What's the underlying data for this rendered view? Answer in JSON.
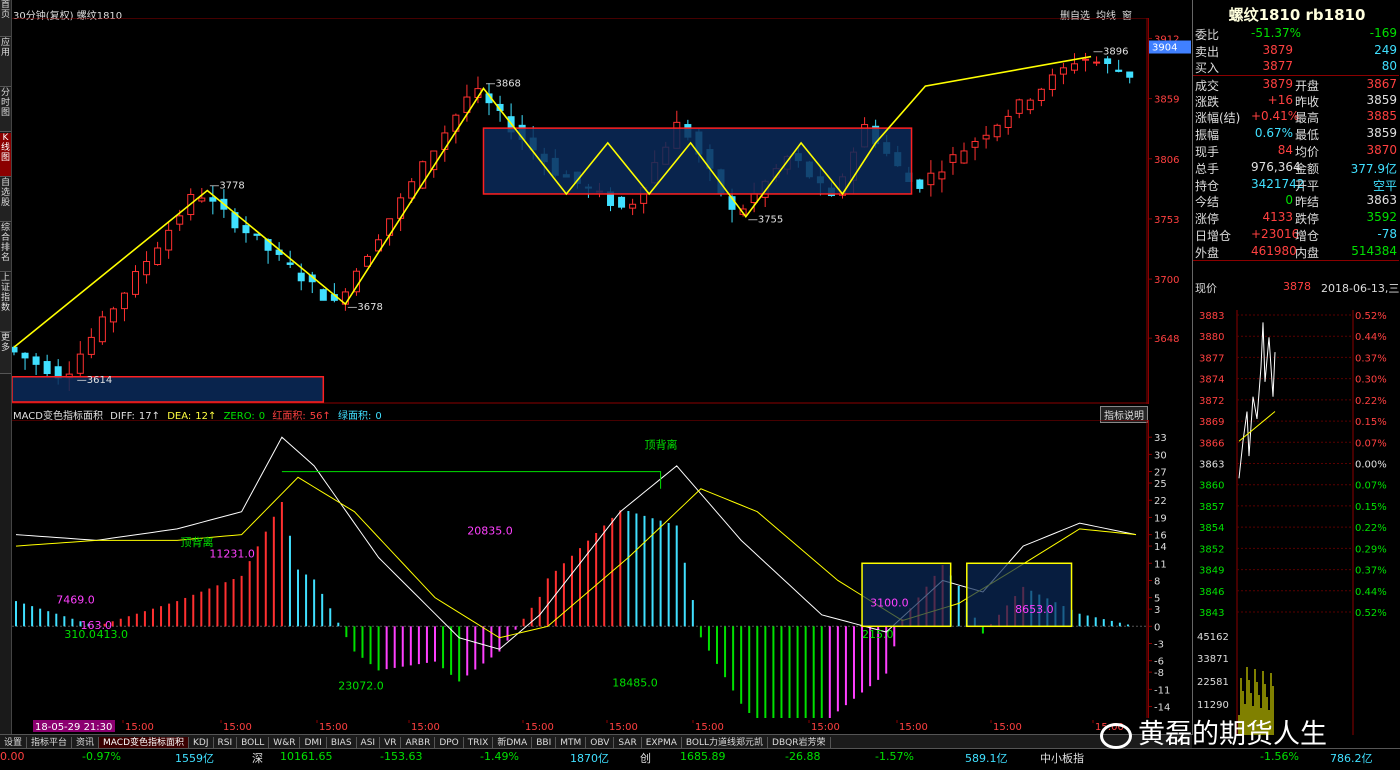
{
  "window": {
    "title": "30分钟(复权)  螺纹1810",
    "tools": [
      "删自选",
      "均线",
      "窗"
    ]
  },
  "sidebar": {
    "items": [
      "首页",
      "应用",
      "分时图",
      "K线图",
      "自选股",
      "综合排名",
      "上证指数",
      "更多"
    ],
    "active_index": 3
  },
  "price_axis": {
    "labels": [
      "3912",
      "3859",
      "3806",
      "3753",
      "3700",
      "3648"
    ],
    "current_tag": "3904"
  },
  "price_annotations": [
    {
      "label": "3614",
      "kind": "low"
    },
    {
      "label": "3778",
      "kind": "high"
    },
    {
      "label": "3678",
      "kind": "low"
    },
    {
      "label": "3868",
      "kind": "high"
    },
    {
      "label": "3755",
      "kind": "low"
    },
    {
      "label": "3896",
      "kind": "high"
    }
  ],
  "macd": {
    "header": {
      "name": "MACD变色指标面积",
      "diff_label": "DIFF:",
      "diff_value": "17↑",
      "dea_label": "DEA:",
      "dea_value": "12↑",
      "zero_label": "ZERO:",
      "zero_value": "0",
      "red_label": "红面积:",
      "red_value": "56↑",
      "green_label": "绿面积:",
      "green_value": "0"
    },
    "help_button": "指标说明",
    "axis_labels": [
      "33",
      "30",
      "27",
      "25",
      "22",
      "19",
      "16",
      "14",
      "11",
      "8",
      "5",
      "3",
      "0",
      "-3",
      "-6",
      "-8",
      "-11",
      "-14"
    ],
    "annotations": [
      {
        "text": "顶背离",
        "color": "#00e000"
      },
      {
        "text": "顶背离",
        "color": "#00e000"
      },
      {
        "text": "7469.0",
        "color": "#ff40ff"
      },
      {
        "text": "310.0",
        "color": "#00e000"
      },
      {
        "text": "413.0",
        "color": "#00e000"
      },
      {
        "text": "163.0",
        "color": "#ff40ff"
      },
      {
        "text": "11231.0",
        "color": "#ff40ff"
      },
      {
        "text": "23072.0",
        "color": "#00e000"
      },
      {
        "text": "20835.0",
        "color": "#ff40ff"
      },
      {
        "text": "18485.0",
        "color": "#00e000"
      },
      {
        "text": "3100.0",
        "color": "#ff40ff"
      },
      {
        "text": "215.0",
        "color": "#00e000"
      },
      {
        "text": "8653.0",
        "color": "#ff40ff"
      }
    ]
  },
  "time_axis": {
    "cursor_label": "18-05-29 21:30",
    "labels": [
      "15:00",
      "15:00",
      "15:00",
      "15:00",
      "15:00",
      "15:00",
      "15:00",
      "15:00",
      "15:00",
      "15:00",
      "15:00"
    ]
  },
  "tabs": [
    "设置",
    "指标平台",
    "资讯",
    "MACD变色指标面积",
    "KDJ",
    "RSI",
    "BOLL",
    "W&R",
    "DMI",
    "BIAS",
    "ASI",
    "VR",
    "ARBR",
    "DPO",
    "TRIX",
    "新DMA",
    "BBI",
    "MTM",
    "OBV",
    "SAR",
    "EXPMA",
    "BOLL力道线郑元凯",
    "DBQR岩芳荣"
  ],
  "active_tab": 3,
  "status_bar": [
    {
      "text": "0.00",
      "color": "#ff4040"
    },
    {
      "text": "-0.97%",
      "color": "#00e000"
    },
    {
      "text": "1559亿",
      "color": "#40e0ff"
    },
    {
      "text": "深",
      "color": "#e0e0e0"
    },
    {
      "text": "10161.65",
      "color": "#00e000"
    },
    {
      "text": "-153.63",
      "color": "#00e000"
    },
    {
      "text": "-1.49%",
      "color": "#00e000"
    },
    {
      "text": "1870亿",
      "color": "#40e0ff"
    },
    {
      "text": "创",
      "color": "#e0e0e0"
    },
    {
      "text": "1685.89",
      "color": "#00e000"
    },
    {
      "text": "-26.88",
      "color": "#00e000"
    },
    {
      "text": "-1.57%",
      "color": "#00e000"
    },
    {
      "text": "589.1亿",
      "color": "#40e0ff"
    },
    {
      "text": "中小板指",
      "color": "#e0e0e0"
    },
    {
      "text": "-1.56%",
      "color": "#00e000"
    },
    {
      "text": "786.2亿",
      "color": "#40e0ff"
    }
  ],
  "quote": {
    "title": "螺纹1810 rb1810",
    "rows": [
      {
        "l1": "委比",
        "v1": "-51.37%",
        "c1": "#00e000",
        "l2": "",
        "v2": "-169",
        "c2": "#00e000"
      },
      {
        "l1": "卖出",
        "v1": "3879",
        "c1": "#ff4040",
        "l2": "",
        "v2": "249",
        "c2": "#40e0ff"
      },
      {
        "l1": "买入",
        "v1": "3877",
        "c1": "#ff4040",
        "l2": "",
        "v2": "80",
        "c2": "#40e0ff"
      },
      {
        "l1": "成交",
        "v1": "3879",
        "c1": "#ff4040",
        "l2": "开盘",
        "v2": "3867",
        "c2": "#ff4040"
      },
      {
        "l1": "涨跌",
        "v1": "+16",
        "c1": "#ff4040",
        "l2": "昨收",
        "v2": "3859",
        "c2": "#e0e0e0"
      },
      {
        "l1": "涨幅(结)",
        "v1": "+0.41%",
        "c1": "#ff4040",
        "l2": "最高",
        "v2": "3885",
        "c2": "#ff4040"
      },
      {
        "l1": "振幅",
        "v1": "0.67%",
        "c1": "#40e0ff",
        "l2": "最低",
        "v2": "3859",
        "c2": "#e0e0e0"
      },
      {
        "l1": "现手",
        "v1": "84",
        "c1": "#ff4040",
        "l2": "均价",
        "v2": "3870",
        "c2": "#ff4040"
      },
      {
        "l1": "总手",
        "v1": "976,364",
        "c1": "#e0e0e0",
        "l2": "金额",
        "v2": "377.9亿",
        "c2": "#40e0ff"
      },
      {
        "l1": "持仓",
        "v1": "3421742",
        "c1": "#40e0ff",
        "l2": "开平",
        "v2": "空平",
        "c2": "#40e0ff"
      },
      {
        "l1": "今结",
        "v1": "0",
        "c1": "#00e000",
        "l2": "昨结",
        "v2": "3863",
        "c2": "#e0e0e0"
      },
      {
        "l1": "涨停",
        "v1": "4133",
        "c1": "#ff4040",
        "l2": "跌停",
        "v2": "3592",
        "c2": "#00e000"
      },
      {
        "l1": "日增仓",
        "v1": "+23016",
        "c1": "#ff4040",
        "l2": "增仓",
        "v2": "-78",
        "c2": "#40e0ff"
      },
      {
        "l1": "外盘",
        "v1": "461980",
        "c1": "#ff4040",
        "l2": "内盘",
        "v2": "514384",
        "c2": "#00e000"
      }
    ],
    "now_label": "现价",
    "now_value": "3878",
    "now_date": "2018-06-13,三"
  },
  "mini_chart": {
    "price_labels": [
      "3883",
      "3880",
      "3877",
      "3874",
      "3872",
      "3869",
      "3866",
      "3863",
      "3860",
      "3857",
      "3854",
      "3852",
      "3849",
      "3846",
      "3843"
    ],
    "pct_labels": [
      "0.52%",
      "0.44%",
      "0.37%",
      "0.30%",
      "0.22%",
      "0.15%",
      "0.07%",
      "0.00%",
      "0.07%",
      "0.15%",
      "0.22%",
      "0.29%",
      "0.37%",
      "0.44%",
      "0.52%"
    ],
    "vol_labels": [
      "45162",
      "33871",
      "22581",
      "11290"
    ]
  },
  "watermark": "黄磊的期货人生"
}
